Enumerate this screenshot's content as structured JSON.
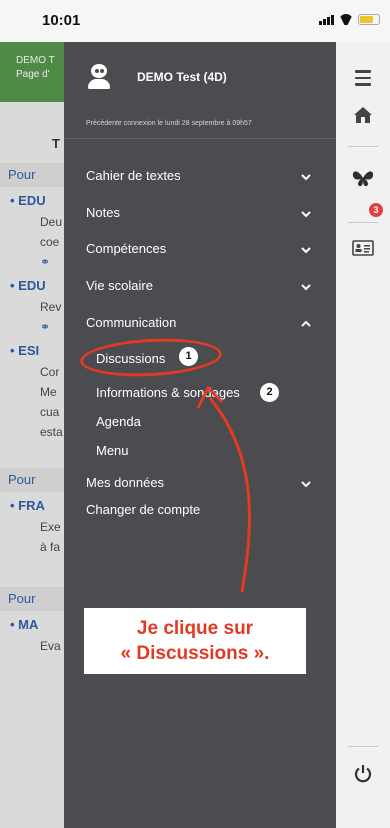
{
  "status_bar": {
    "time": "10:01"
  },
  "background": {
    "header_line1": "DEMO T",
    "header_line2": "Page d'",
    "top_letter": "T",
    "sections": [
      {
        "title": "Pour",
        "items": [
          {
            "title": "EDU",
            "lines": [
              "Deu",
              "coe"
            ]
          },
          {
            "title": "EDU",
            "lines": [
              "Rev"
            ]
          },
          {
            "title": "ESI",
            "lines": [
              "Cor",
              "Me",
              "cua",
              "esta"
            ]
          }
        ]
      },
      {
        "title": "Pour",
        "items": [
          {
            "title": "FRA",
            "lines": [
              "Exe",
              "à fa"
            ]
          }
        ]
      },
      {
        "title": "Pour",
        "items": [
          {
            "title": "MA",
            "lines": [
              "Eva"
            ]
          }
        ]
      }
    ]
  },
  "drawer": {
    "user_name": "DEMO Test (4D)",
    "last_login": "Précédente connexion le lundi 28 septembre à 09h57",
    "menu": {
      "cahier": "Cahier de textes",
      "notes": "Notes",
      "competences": "Compétences",
      "vie_scolaire": "Vie scolaire",
      "communication": "Communication",
      "mes_donnees": "Mes données",
      "changer_compte": "Changer de compte"
    },
    "submenu": {
      "discussions": "Discussions",
      "informations": "Informations & sondages",
      "agenda": "Agenda",
      "menu": "Menu"
    },
    "badges": {
      "step1": "1",
      "step2": "2"
    }
  },
  "annotation": {
    "line1": "Je clique sur",
    "line2": "« Discussions »."
  },
  "rail": {
    "notification_count": "3"
  },
  "colors": {
    "drawer_bg": "#4a4c4f",
    "annotation_red": "#e23a24",
    "header_green": "#4f8a47"
  }
}
